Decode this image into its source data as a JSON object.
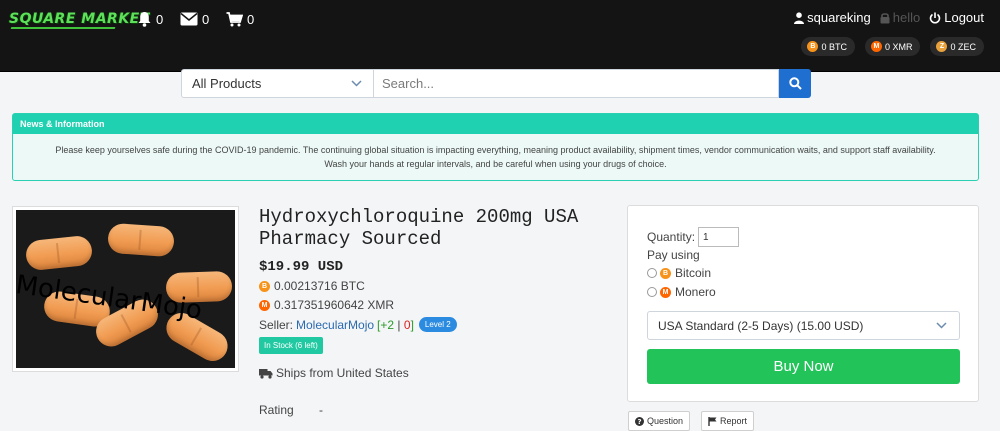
{
  "header": {
    "logo_text": "SQUARE MARKET",
    "notifications_count": "0",
    "messages_count": "0",
    "cart_count": "0",
    "username": "squareking",
    "hello_text": "hello",
    "logout_label": "Logout",
    "balances": [
      {
        "label": "0 BTC",
        "coin": "btc-coin-icon"
      },
      {
        "label": "0 XMR",
        "coin": "xmr-coin-icon"
      },
      {
        "label": "0 ZEC",
        "coin": "zec-coin-icon"
      }
    ]
  },
  "search": {
    "category_selected": "All Products",
    "placeholder": "Search..."
  },
  "news": {
    "heading": "News & Information",
    "line1": "Please keep yourselves safe during the COVID-19 pandemic. The continuing global situation is impacting everything, meaning product availability, shipment times, vendor communication waits, and support staff availability.",
    "line2": "Wash your hands at regular intervals, and be careful when using your drugs of choice."
  },
  "product": {
    "image_watermark": "MolecularMojo",
    "title": "Hydroxychloroquine 200mg USA Pharmacy Sourced",
    "price_usd": "$19.99 USD",
    "price_btc": "0.00213716 BTC",
    "price_xmr": "0.317351960642 XMR",
    "seller_label": "Seller:",
    "seller_name": "MolecularMojo",
    "feedback_open": "[",
    "feedback_positive": "+2",
    "feedback_sep": " | ",
    "feedback_negative": "0",
    "feedback_close": "]",
    "level_badge": "Level 2",
    "stock_badge": "In Stock (6 left)",
    "ships_from": "Ships from United States",
    "rating_label": "Rating",
    "rating_value": "-"
  },
  "purchase": {
    "quantity_label": "Quantity:",
    "quantity_value": "1",
    "pay_using_label": "Pay using",
    "payment_options": [
      "Bitcoin",
      "Monero"
    ],
    "shipping_selected": "USA Standard (2-5 Days) (15.00 USD)",
    "buy_label": "Buy Now",
    "question_label": "Question",
    "report_label": "Report"
  },
  "colors": {
    "topbar": "#141414",
    "accent_teal": "#1fd1b0",
    "buy_green": "#22c45a",
    "search_blue": "#1f6fd1",
    "bitcoin": "#f7931a",
    "monero": "#ff6600"
  }
}
